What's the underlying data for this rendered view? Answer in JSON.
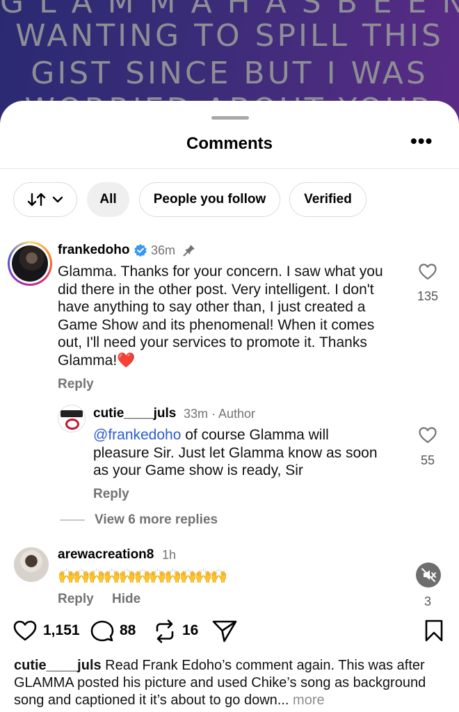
{
  "background_post": {
    "lines": [
      "G L A M M A   H A S   B E E N",
      "WANTING TO SPILL THIS",
      "GIST SINCE BUT I WAS",
      "WORRIED ABOUT YOUR"
    ]
  },
  "header": {
    "title": "Comments"
  },
  "filters": [
    "All",
    "People you follow",
    "Verified"
  ],
  "comments": [
    {
      "username": "frankedoho",
      "time": "36m",
      "text": "Glamma. Thanks for your concern. I saw what you did there in the other post.  Very intelligent.  I don't have anything to say other than, I just created a Game Show and its phenomenal! When it comes out, I'll need your services to promote it. Thanks Glamma!❤️",
      "likes": "135",
      "reply_label": "Reply",
      "replies": [
        {
          "username": "cutie____juls",
          "time": "33m · Author",
          "mention": "@frankedoho",
          "text": " of course Glamma will pleasure Sir. Just let Glamma know as soon as your Game show is ready, Sir",
          "likes": "55",
          "reply_label": "Reply"
        }
      ],
      "view_more": "View 6 more replies"
    },
    {
      "username": "arewacreation8",
      "time": "1h",
      "text": "🙌🙌🙌🙌🙌🙌🙌🙌🙌🙌🙌",
      "reply_label": "Reply",
      "hide_label": "Hide",
      "count": "3"
    }
  ],
  "actions": {
    "likes": "1,151",
    "comments": "88",
    "reposts": "16"
  },
  "caption": {
    "username": "cutie____juls",
    "text": " Read Frank Edoho’s comment again. This was after GLAMMA posted his picture and used Chike’s song as background song and captioned it it’s about to go down...",
    "more": "more"
  },
  "colors": {
    "accent_blue": "#2c5bd6",
    "verified": "#3897f0",
    "gradient_ring": "#c13584",
    "heart_red": "#e0245e"
  },
  "icons": [
    "sort-icon",
    "chevron-down-icon",
    "more-options-icon",
    "verified-badge-icon",
    "pin-icon",
    "heart-icon",
    "mute-icon",
    "comment-icon",
    "repost-icon",
    "share-icon",
    "bookmark-icon"
  ]
}
